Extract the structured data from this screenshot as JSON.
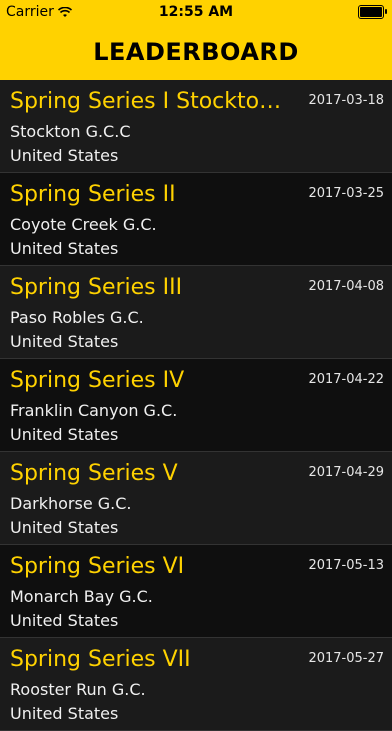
{
  "status": {
    "carrier": "Carrier",
    "time": "12:55 AM"
  },
  "header": {
    "title": "LEADERBOARD"
  },
  "events": [
    {
      "name": "Spring Series I Stockton…",
      "date": "2017-03-18",
      "club": "Stockton G.C.C",
      "country": "United States"
    },
    {
      "name": "Spring Series II",
      "date": "2017-03-25",
      "club": "Coyote Creek G.C.",
      "country": "United States"
    },
    {
      "name": "Spring Series III",
      "date": "2017-04-08",
      "club": "Paso Robles G.C.",
      "country": "United States"
    },
    {
      "name": "Spring Series IV",
      "date": "2017-04-22",
      "club": "Franklin Canyon G.C.",
      "country": "United States"
    },
    {
      "name": "Spring Series V",
      "date": "2017-04-29",
      "club": "Darkhorse G.C.",
      "country": "United States"
    },
    {
      "name": "Spring Series VI",
      "date": "2017-05-13",
      "club": "Monarch Bay G.C.",
      "country": "United States"
    },
    {
      "name": "Spring Series VII",
      "date": "2017-05-27",
      "club": "Rooster Run G.C.",
      "country": "United States"
    }
  ]
}
